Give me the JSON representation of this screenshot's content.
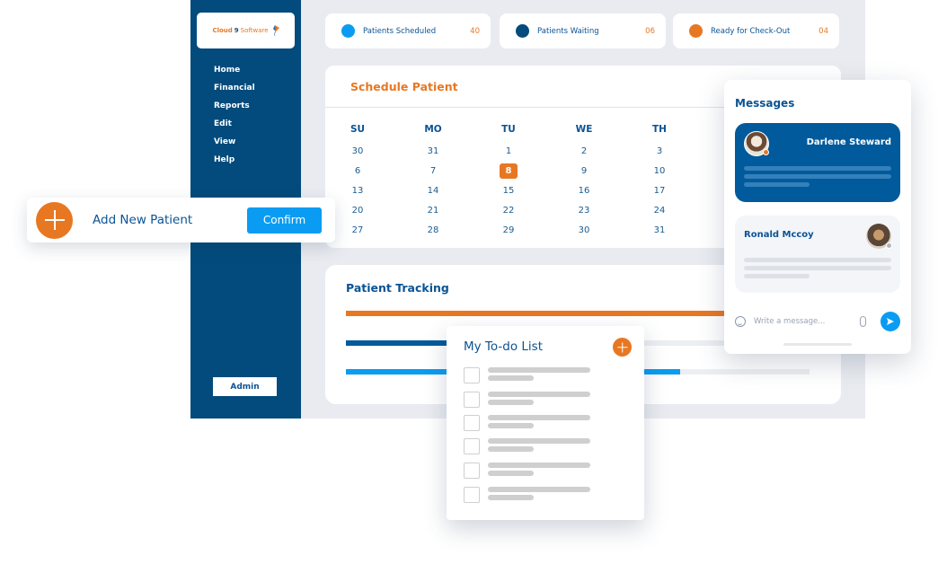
{
  "colors": {
    "brand_dark": "#024b7c",
    "brand_blue": "#0b5394",
    "accent_orange": "#e87722",
    "accent_blue": "#0a9cf2",
    "app_background": "#e9ebf0"
  },
  "sidebar": {
    "logo": {
      "part1": "Cloud",
      "part2": "9",
      "part3": "Software",
      "icon": "kite-icon"
    },
    "items": [
      {
        "label": "Home"
      },
      {
        "label": "Financial"
      },
      {
        "label": "Reports"
      },
      {
        "label": "Edit"
      },
      {
        "label": "View"
      },
      {
        "label": "Help"
      }
    ],
    "admin_label": "Admin"
  },
  "stats": [
    {
      "label": "Patients Scheduled",
      "count": "40",
      "color": "#0a9cf2"
    },
    {
      "label": "Patients Waiting",
      "count": "06",
      "color": "#024b7c"
    },
    {
      "label": "Ready for Check-Out",
      "count": "04",
      "color": "#e87722"
    }
  ],
  "schedule": {
    "title": "Schedule Patient",
    "weekdays": [
      "SU",
      "MO",
      "TU",
      "WE",
      "TH"
    ],
    "weeks": [
      [
        "30",
        "31",
        "1",
        "2",
        "3"
      ],
      [
        "6",
        "7",
        "8",
        "9",
        "10"
      ],
      [
        "13",
        "14",
        "15",
        "16",
        "17"
      ],
      [
        "20",
        "21",
        "22",
        "23",
        "24"
      ],
      [
        "27",
        "28",
        "29",
        "30",
        "31"
      ]
    ],
    "selected_day": "8"
  },
  "add_patient": {
    "label": "Add New Patient",
    "confirm_label": "Confirm"
  },
  "tracking": {
    "title": "Patient Tracking",
    "bars": [
      {
        "name": "scheduled",
        "color": "#e87722",
        "progress": 1.0
      },
      {
        "name": "waiting",
        "color": "#005a9c",
        "progress": 0.45
      },
      {
        "name": "checkout",
        "color": "#0a9cf2",
        "progress": 0.72
      }
    ]
  },
  "messages": {
    "title": "Messages",
    "threads": [
      {
        "name": "Darlene Steward",
        "active": true,
        "status_color": "#e87722"
      },
      {
        "name": "Ronald Mccoy",
        "active": false,
        "status_color": "#b0b6bf"
      }
    ],
    "compose_placeholder": "Write a message..."
  },
  "todo": {
    "title": "My To-do List",
    "items": [
      {
        "checked": false
      },
      {
        "checked": false
      },
      {
        "checked": false
      },
      {
        "checked": false
      },
      {
        "checked": false
      },
      {
        "checked": false
      }
    ]
  }
}
